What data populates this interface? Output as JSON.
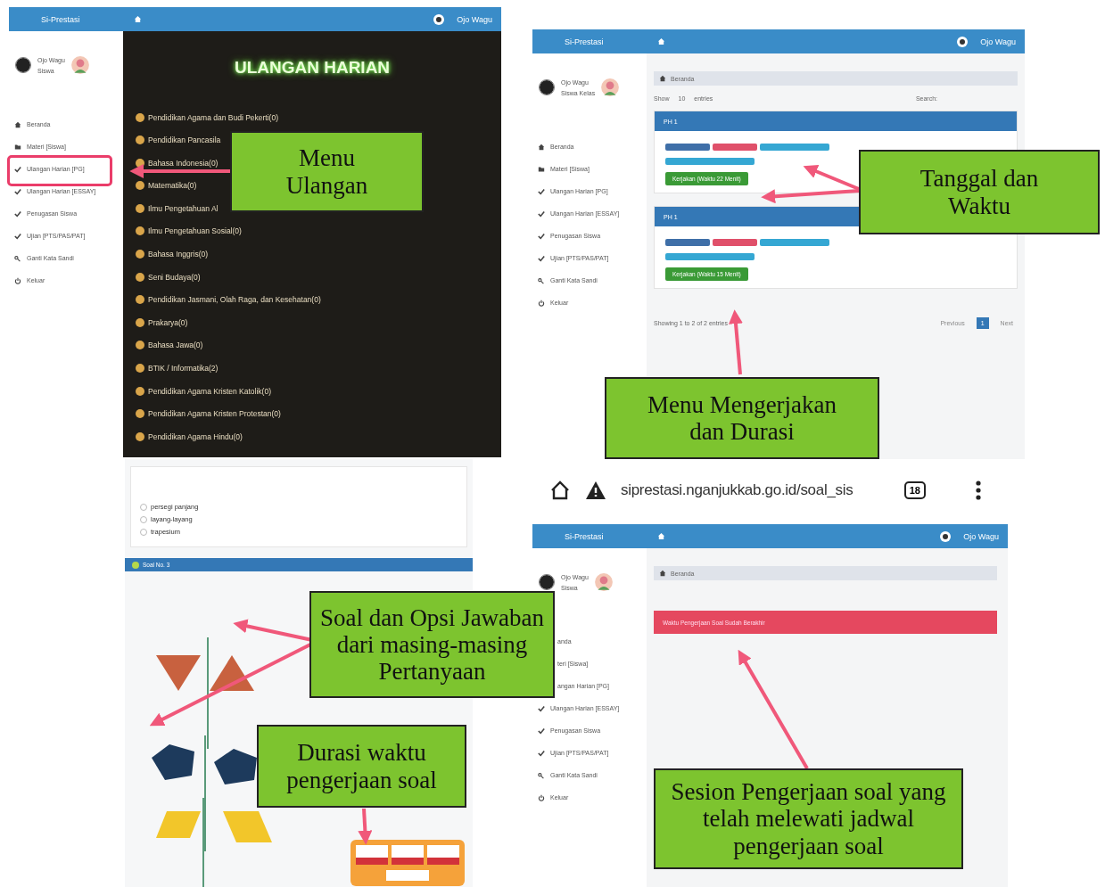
{
  "subjects_panel": {
    "brand": "Si-Prestasi",
    "user": "Ojo Wagu",
    "profile": [
      "Ojo Wagu",
      "Siswa"
    ],
    "menu": [
      {
        "label": "Beranda",
        "kind": "home"
      },
      {
        "label": "Materi [Siswa]",
        "kind": "folder"
      },
      {
        "label": "Ulangan Harian [PG]",
        "kind": "check"
      },
      {
        "label": "Ulangan Harian [ESSAY]",
        "kind": "check"
      },
      {
        "label": "Penugasan Siswa",
        "kind": "check"
      },
      {
        "label": "Ujian [PTS/PAS/PAT]",
        "kind": "check"
      },
      {
        "label": "Ganti Kata Sandi",
        "kind": "key"
      },
      {
        "label": "Keluar",
        "kind": "power"
      }
    ],
    "title": "ULANGAN HARIAN",
    "subjects": [
      "Pendidikan Agama dan Budi Pekerti(0)",
      "Pendidikan Pancasila",
      "Bahasa Indonesia(0)",
      "Matematika(0)",
      "Ilmu Pengetahuan Al",
      "Ilmu Pengetahuan Sosial(0)",
      "Bahasa Inggris(0)",
      "Seni Budaya(0)",
      "Pendidikan Jasmani, Olah Raga, dan Kesehatan(0)",
      "Prakarya(0)",
      "Bahasa Jawa(0)",
      "BTIK / Informatika(2)",
      "Pendidikan Agama Kristen Katolik(0)",
      "Pendidikan Agama Kristen Protestan(0)",
      "Pendidikan Agama Hindu(0)"
    ],
    "callout": [
      "Menu",
      "Ulangan"
    ]
  },
  "exams_panel": {
    "brand": "Si-Prestasi",
    "user": "Ojo Wagu",
    "profile": [
      "Ojo Wagu",
      "Siswa Kelas"
    ],
    "menu": [
      {
        "label": "Beranda",
        "kind": "home"
      },
      {
        "label": "Materi [Siswa]",
        "kind": "folder"
      },
      {
        "label": "Ulangan Harian [PG]",
        "kind": "check"
      },
      {
        "label": "Ulangan Harian [ESSAY]",
        "kind": "check"
      },
      {
        "label": "Penugasan Siswa",
        "kind": "check"
      },
      {
        "label": "Ujian [PTS/PAS/PAT]",
        "kind": "check"
      },
      {
        "label": "Ganti Kata Sandi",
        "kind": "key"
      },
      {
        "label": "Keluar",
        "kind": "power"
      }
    ],
    "breadcrumb": "Beranda",
    "show_label": "Show",
    "entries_value": "10",
    "entries_label": "entries",
    "search_label": "Search:",
    "cards": [
      {
        "title": "PH 1",
        "badges": [
          {
            "color": "#3f6fa8"
          },
          {
            "color": "#e0506a"
          },
          {
            "color": "#35a7d3"
          }
        ],
        "time_badge": {
          "color": "#35a7d3"
        },
        "button": "Kerjakan (Waktu 22 Menit)"
      },
      {
        "title": "PH 1",
        "badges": [
          {
            "color": "#3f6fa8"
          },
          {
            "color": "#e0506a"
          },
          {
            "color": "#35a7d3"
          }
        ],
        "time_badge": {
          "color": "#35a7d3"
        },
        "button": "Kerjakan (Waktu 15 Menit)"
      }
    ],
    "footer": "Showing 1 to 2 of 2 entries",
    "pages": [
      {
        "label": "Previous",
        "selected": false
      },
      {
        "label": "1",
        "selected": true
      },
      {
        "label": "Next",
        "selected": false
      }
    ],
    "callouts": [
      [
        "Tanggal dan",
        "Waktu"
      ],
      [
        "Menu Mengerjakan",
        "dan Durasi"
      ]
    ]
  },
  "question_panel": {
    "options": [
      {
        "label": "persegi panjang",
        "selected": false
      },
      {
        "label": "layang-layang",
        "selected": false
      },
      {
        "label": "trapesium",
        "selected": false
      }
    ],
    "question_bar": "Soal No. 3",
    "callouts": [
      [
        "Soal dan Opsi Jawaban",
        "dari masing-masing",
        "Pertanyaan"
      ],
      [
        "Durasi waktu",
        "pengerjaan soal"
      ]
    ]
  },
  "expired_panel": {
    "address": "siprestasi.nganjukkab.go.id/soal_sis",
    "tab_count": "18",
    "brand": "Si-Prestasi",
    "user": "Ojo Wagu",
    "profile": [
      "Ojo Wagu",
      "Siswa"
    ],
    "menu": [
      {
        "label": "anda",
        "kind": "cut"
      },
      {
        "label": "teri [Siswa]",
        "kind": "cut"
      },
      {
        "label": "angan Harian [PG]",
        "kind": "cut"
      },
      {
        "label": "Ulangan Harian [ESSAY]",
        "kind": "check"
      },
      {
        "label": "Penugasan Siswa",
        "kind": "check"
      },
      {
        "label": "Ujian [PTS/PAS/PAT]",
        "kind": "check"
      },
      {
        "label": "Ganti Kata Sandi",
        "kind": "key"
      },
      {
        "label": "Keluar",
        "kind": "power"
      }
    ],
    "breadcrumb": "Beranda",
    "alert": "Waktu Pengerjaan Soal Sudah Berakhir",
    "callout": [
      "Sesion Pengerjaan soal yang",
      "telah melewati jadwal",
      "pengerjaan soal"
    ]
  }
}
